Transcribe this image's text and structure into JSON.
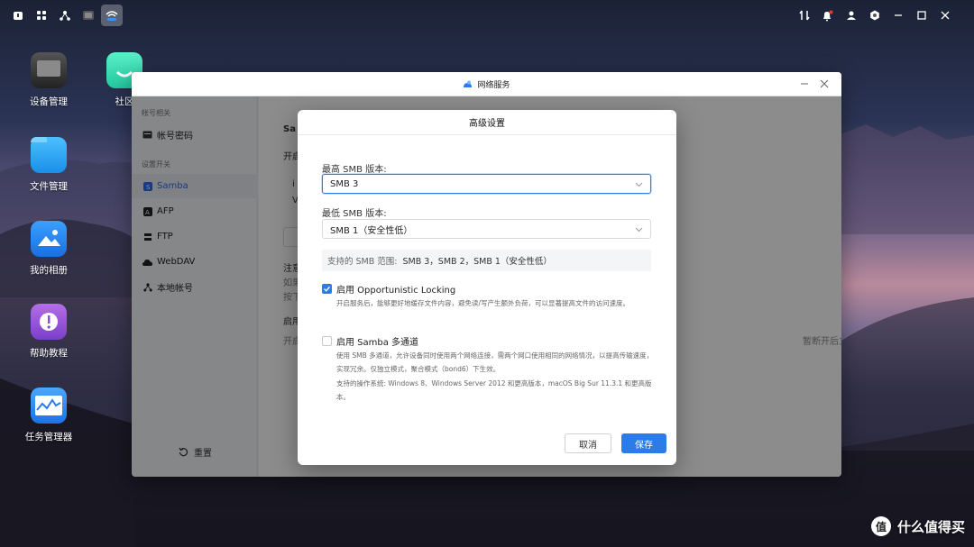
{
  "desktop": {
    "icons": [
      {
        "label": "设备管理"
      },
      {
        "label": "社区"
      },
      {
        "label": "文件管理"
      },
      {
        "label": "我的相册"
      },
      {
        "label": "帮助教程"
      },
      {
        "label": "任务管理器"
      }
    ]
  },
  "window": {
    "title": "网络服务",
    "sidebar": {
      "section_account": "帐号相关",
      "item_account_password": "帐号密码",
      "section_settings": "设置开关",
      "items": [
        "Samba",
        "AFP",
        "FTP",
        "WebDAV",
        "本地帐号"
      ],
      "reset": "重置"
    },
    "content": {
      "heading": "Sa",
      "line1": "开启",
      "line2": "i",
      "line3": "V",
      "note": "注意",
      "note2": "如果",
      "note3": "按下",
      "enable": "启用",
      "enable_desc": "开启",
      "right_text": "暂断开后立即恢复。"
    }
  },
  "modal": {
    "title": "高级设置",
    "max_smb_label": "最高 SMB 版本:",
    "max_smb_value": "SMB 3",
    "min_smb_label": "最低 SMB 版本:",
    "min_smb_value": "SMB 1（安全性低）",
    "range_key": "支持的 SMB 范围:",
    "range_value": "SMB 3，SMB 2，SMB 1（安全性低）",
    "oplock_label": "启用 Opportunistic Locking",
    "oplock_checked": true,
    "oplock_desc": "开启服务后，能够更好地缓存文件内容，避免读/写产生额外负荷，可以显著提高文件的访问速度。",
    "multichannel_label": "启用 Samba 多通道",
    "multichannel_checked": false,
    "multichannel_desc1": "使用 SMB 多通道，允许设备同时使用两个网络连接，需两个网口使用相同的网络情况，以提高传输速度，实现冗余。仅独立模式，聚合模式（bond6）下生效。",
    "multichannel_desc2": "支持的操作系统: Windows 8、Windows Server 2012 和更高版本，macOS Big Sur 11.3.1 和更高版本。",
    "cancel": "取消",
    "save": "保存"
  },
  "watermark": {
    "logo": "值",
    "text": "什么值得买"
  },
  "colors": {
    "accent": "#2b7ce9",
    "sidebar_active_bg": "#e7ebf3"
  }
}
